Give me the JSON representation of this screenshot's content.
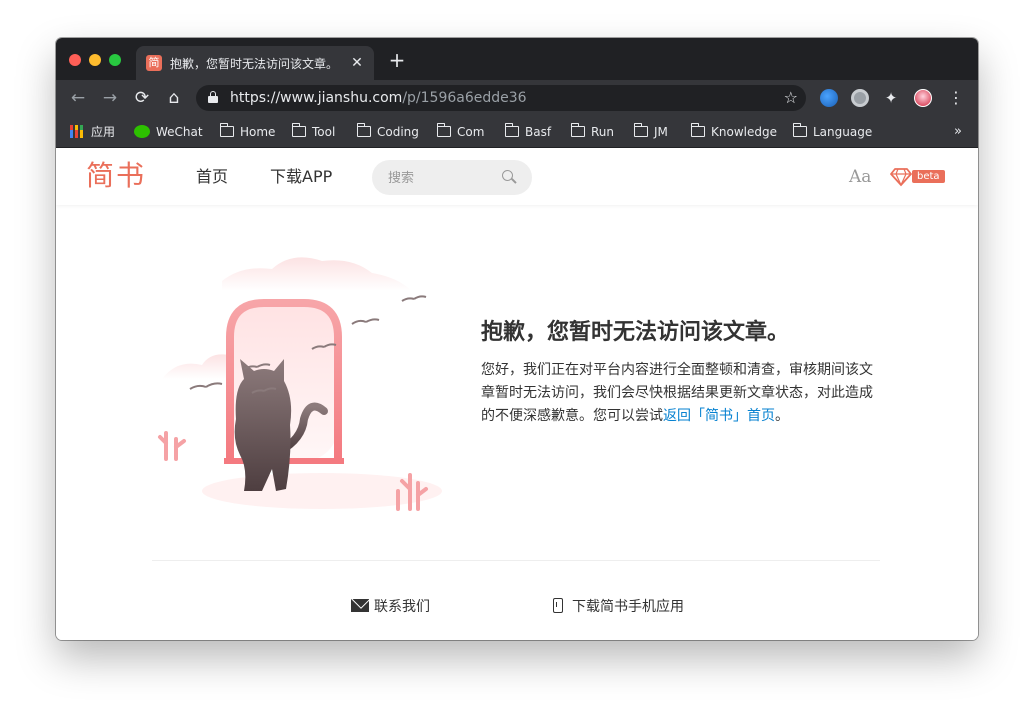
{
  "browser": {
    "tab": {
      "favicon": "简",
      "title": "抱歉，您暂时无法访问该文章。 - 简书",
      "close": "✕"
    },
    "new_tab": "+",
    "nav": {
      "back": "←",
      "forward": "→",
      "reload": "⟳",
      "home": "⌂"
    },
    "url": {
      "host": "https://www.jianshu.com",
      "path": "/p/1596a6edde36"
    },
    "star": "☆",
    "puzzle": "✦",
    "menu": "⋮",
    "bookmarks": [
      {
        "label": "应用",
        "icon": "apps-icon"
      },
      {
        "label": "WeChat",
        "icon": "wechat-icon"
      },
      {
        "label": "Home",
        "icon": "folder-icon"
      },
      {
        "label": "Tool",
        "icon": "folder-icon"
      },
      {
        "label": "Coding",
        "icon": "folder-icon"
      },
      {
        "label": "Com",
        "icon": "folder-icon"
      },
      {
        "label": "Basf",
        "icon": "folder-icon"
      },
      {
        "label": "Run",
        "icon": "folder-icon"
      },
      {
        "label": "JM",
        "icon": "folder-icon"
      },
      {
        "label": "Knowledge",
        "icon": "folder-icon"
      },
      {
        "label": "Language",
        "icon": "folder-icon"
      }
    ],
    "bookmarks_more": "»"
  },
  "site": {
    "logo": "简书",
    "nav": {
      "home": "首页",
      "download_app": "下载APP"
    },
    "search": {
      "placeholder": "搜索"
    },
    "font_toggle": "Aa",
    "beta": "beta",
    "accent_color": "#ea6f5a",
    "link_color": "#0681d0"
  },
  "error": {
    "title": "抱歉，您暂时无法访问该文章。",
    "body": "您好，我们正在对平台内容进行全面整顿和清查，审核期间该文章暂时无法访问，我们会尽快根据结果更新文章状态，对此造成的不便深感歉意。您可以尝试",
    "link": "返回「简书」首页",
    "end": "。"
  },
  "footer": {
    "contact": "联系我们",
    "download": "下载简书手机应用"
  }
}
